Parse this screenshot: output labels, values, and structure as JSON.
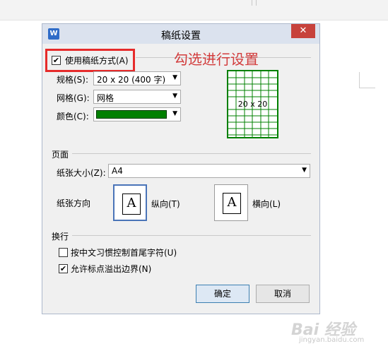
{
  "dialog": {
    "title": "稿纸设置",
    "app_icon": "W",
    "close_icon": "✕",
    "use_grid_paper": {
      "label": "使用稿纸方式(A)",
      "checked": true
    },
    "annotation": "勾选进行设置",
    "spec": {
      "label": "规格(S):",
      "value": "20 x 20 (400 字)"
    },
    "grid": {
      "label": "网格(G):",
      "value": "网格"
    },
    "color": {
      "label": "颜色(C):",
      "value": "#008000"
    },
    "preview_caption": "20 x 20",
    "page_group": {
      "title": "页面",
      "paper_size": {
        "label": "纸张大小(Z):",
        "value": "A4"
      },
      "orientation_label": "纸张方向",
      "portrait": {
        "label": "纵向(T)",
        "icon": "A",
        "selected": true
      },
      "landscape": {
        "label": "横向(L)",
        "icon": "A",
        "selected": false
      }
    },
    "wrap_group": {
      "title": "换行",
      "option1": {
        "label": "按中文习惯控制首尾字符(U)",
        "checked": false
      },
      "option2": {
        "label": "允许标点溢出边界(N)",
        "checked": true
      }
    },
    "ok": "确定",
    "cancel": "取消"
  },
  "watermark": {
    "main": "Bai 经验",
    "sub": "jingyan.baidu.com"
  }
}
